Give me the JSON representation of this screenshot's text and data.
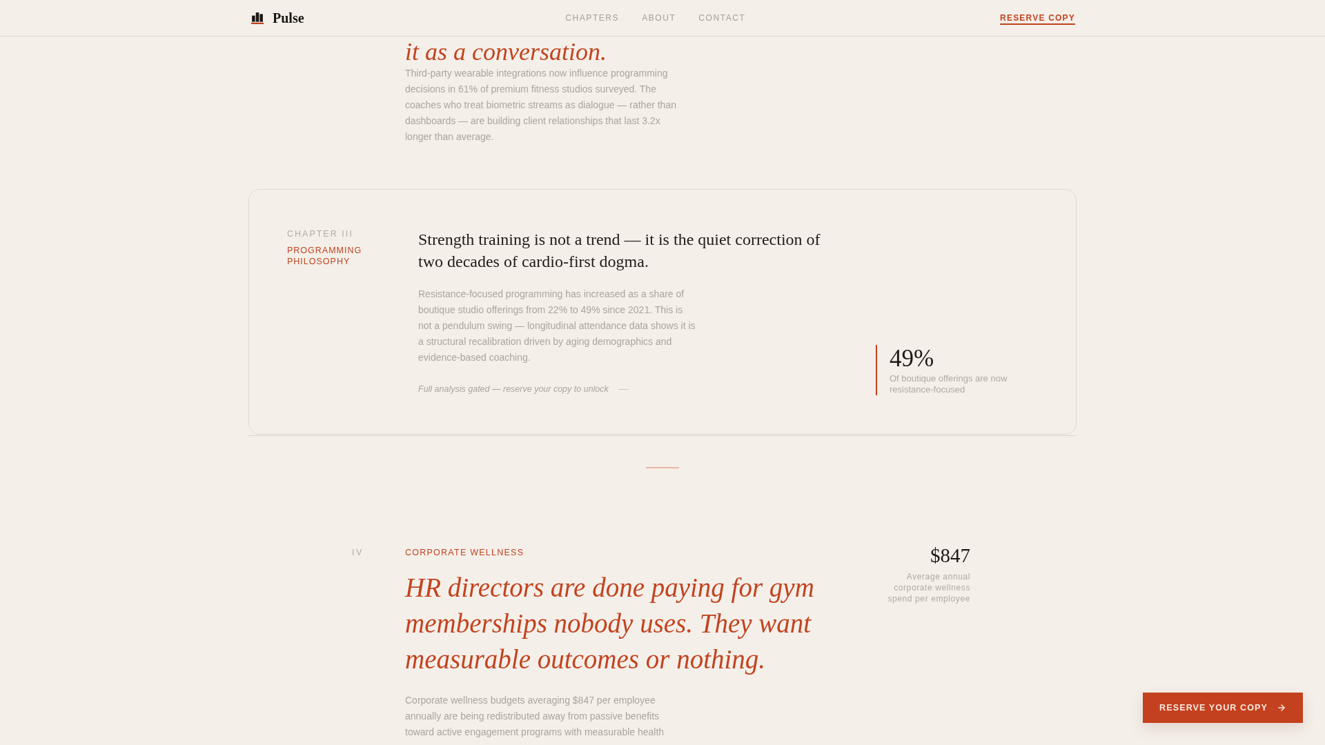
{
  "header": {
    "brand": "Pulse",
    "nav": [
      {
        "label": "CHAPTERS"
      },
      {
        "label": "ABOUT"
      },
      {
        "label": "CONTACT"
      }
    ],
    "cta": "RESERVE COPY"
  },
  "intro": {
    "heading": "it as a conversation.",
    "body": "Third-party wearable integrations now influence programming decisions in 61% of premium fitness studios surveyed. The coaches who treat biometric streams as dialogue — rather than dashboards — are building client relationships that last 3.2x longer than average."
  },
  "chapter_card": {
    "label": "CHAPTER III",
    "title": "PROGRAMMING PHILOSOPHY",
    "headline": "Strength training is not a trend — it is the quiet correction of two decades of cardio-first dogma.",
    "body": "Resistance-focused programming has increased as a share of boutique studio offerings from 22% to 49% since 2021. This is not a pendulum swing — longitudinal attendance data shows it is a structural recalibration driven by aging demographics and evidence-based coaching.",
    "note": "Full analysis gated — reserve your copy to unlock",
    "stat": {
      "value": "49%",
      "caption": "Of boutique offerings are now resistance-focused"
    }
  },
  "chapter_section": {
    "numeral": "IV",
    "label": "CORPORATE WELLNESS",
    "headline": "HR directors are done paying for gym memberships nobody uses. They want measurable outcomes or nothing.",
    "body": "Corporate wellness budgets averaging $847 per employee annually are being redistributed away from passive benefits toward active engagement programs with measurable health",
    "stat": {
      "value": "$847",
      "caption": "Average annual corporate wellness spend per employee"
    }
  },
  "floating_button": {
    "label": "RESERVE YOUR COPY"
  }
}
